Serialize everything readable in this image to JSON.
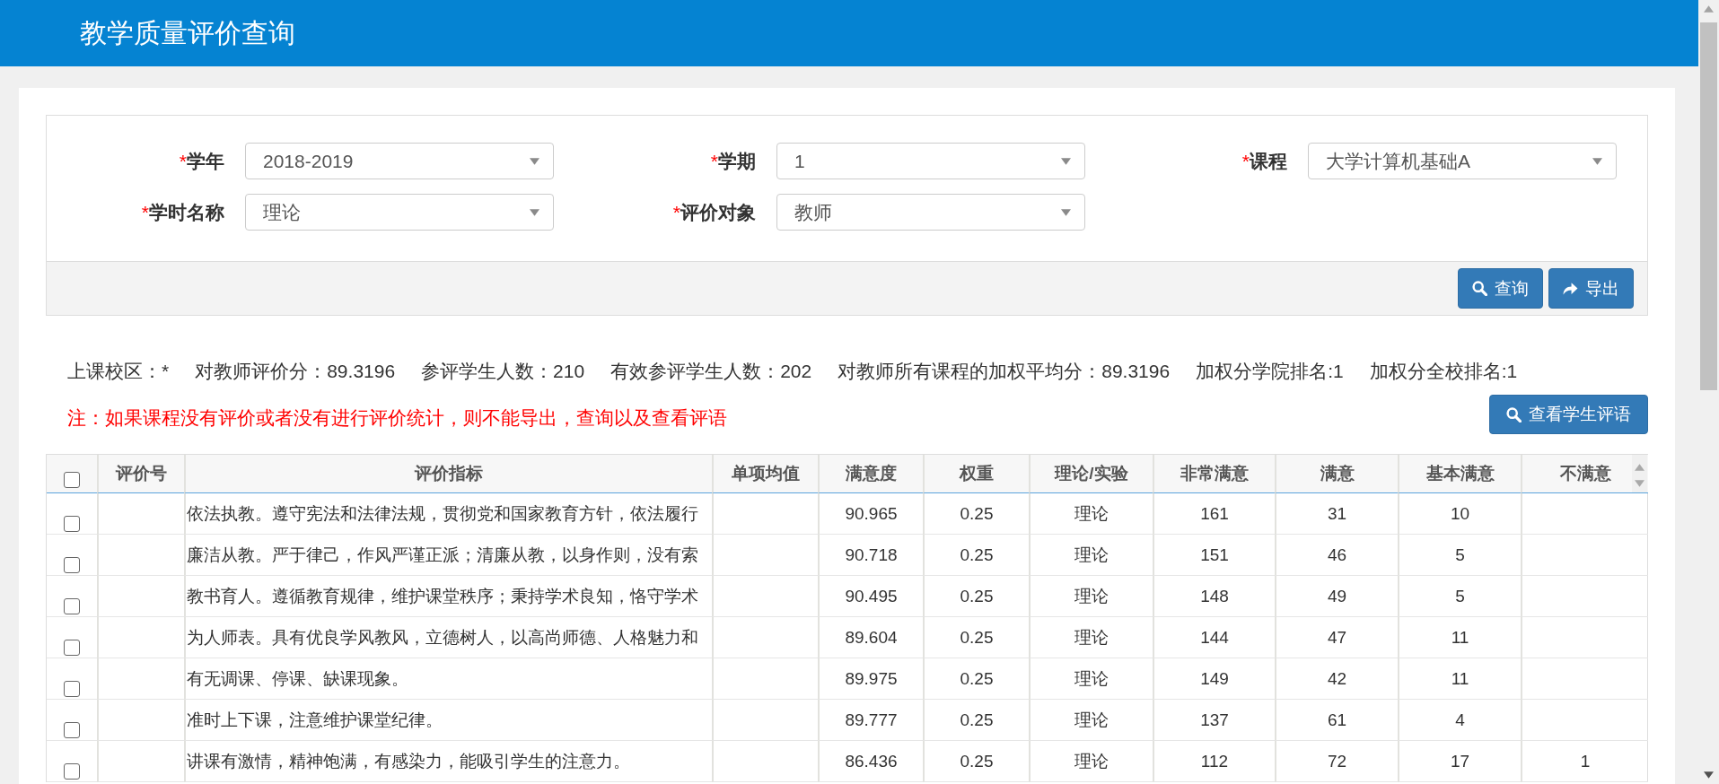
{
  "header": {
    "title": "教学质量评价查询"
  },
  "filters": [
    {
      "required_mark": "*",
      "label": "学年",
      "value": "2018-2019"
    },
    {
      "required_mark": "*",
      "label": "学期",
      "value": "1"
    },
    {
      "required_mark": "*",
      "label": "课程",
      "value": "大学计算机基础A"
    },
    {
      "required_mark": "*",
      "label": "学时名称",
      "value": "理论"
    },
    {
      "required_mark": "*",
      "label": "评价对象",
      "value": "教师"
    }
  ],
  "actions": [
    {
      "kind": "search",
      "label": "查询"
    },
    {
      "kind": "export",
      "label": "导出"
    }
  ],
  "stats": [
    "上课校区：*",
    "对教师评价分：89.3196",
    "参评学生人数：210",
    "有效参评学生人数：202",
    "对教师所有课程的加权平均分：89.3196",
    "加权分学院排名:1",
    "加权分全校排名:1"
  ],
  "notice": "注：如果课程没有评价或者没有进行评价统计，则不能导出，查询以及查看评语",
  "comments_button": {
    "kind": "search",
    "label": "查看学生评语"
  },
  "table": {
    "select_all_checked": false,
    "columns": [
      "评价号",
      "评价指标",
      "单项均值",
      "满意度",
      "权重",
      "理论/实验",
      "非常满意",
      "满意",
      "基本满意",
      "不满意"
    ],
    "rows": [
      {
        "checked": false,
        "indicator": "依法执教。遵守宪法和法律法规，贯彻党和国家教育方针，依法履行",
        "satisfaction": "90.965",
        "weight": "0.25",
        "type": "理论",
        "very_satisfied": "161",
        "satisfied": "31",
        "fairly_satisfied": "10"
      },
      {
        "checked": false,
        "indicator": "廉洁从教。严于律己，作风严谨正派；清廉从教，以身作则，没有索",
        "satisfaction": "90.718",
        "weight": "0.25",
        "type": "理论",
        "very_satisfied": "151",
        "satisfied": "46",
        "fairly_satisfied": "5"
      },
      {
        "checked": false,
        "indicator": "教书育人。遵循教育规律，维护课堂秩序；秉持学术良知，恪守学术",
        "satisfaction": "90.495",
        "weight": "0.25",
        "type": "理论",
        "very_satisfied": "148",
        "satisfied": "49",
        "fairly_satisfied": "5"
      },
      {
        "checked": false,
        "indicator": "为人师表。具有优良学风教风，立德树人，以高尚师德、人格魅力和",
        "satisfaction": "89.604",
        "weight": "0.25",
        "type": "理论",
        "very_satisfied": "144",
        "satisfied": "47",
        "fairly_satisfied": "11"
      },
      {
        "checked": false,
        "indicator": "有无调课、停课、缺课现象。",
        "satisfaction": "89.975",
        "weight": "0.25",
        "type": "理论",
        "very_satisfied": "149",
        "satisfied": "42",
        "fairly_satisfied": "11"
      },
      {
        "checked": false,
        "indicator": "准时上下课，注意维护课堂纪律。",
        "satisfaction": "89.777",
        "weight": "0.25",
        "type": "理论",
        "very_satisfied": "137",
        "satisfied": "61",
        "fairly_satisfied": "4"
      },
      {
        "checked": false,
        "indicator": "讲课有激情，精神饱满，有感染力，能吸引学生的注意力。",
        "satisfaction": "86.436",
        "weight": "0.25",
        "type": "理论",
        "very_satisfied": "112",
        "satisfied": "72",
        "fairly_satisfied": "17",
        "dissatisfied": "1"
      }
    ]
  }
}
